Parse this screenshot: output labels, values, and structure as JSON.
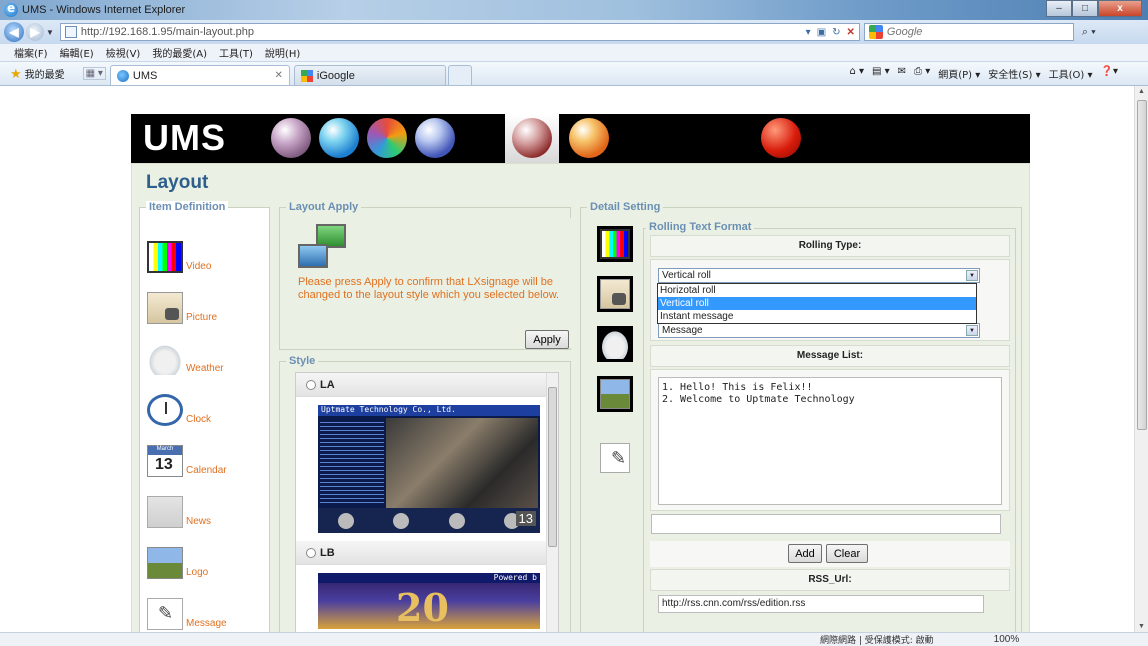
{
  "window": {
    "title": "UMS - Windows Internet Explorer",
    "min": "–",
    "max": "□",
    "close": "x"
  },
  "address": {
    "url": "http://192.168.1.95/main-layout.php",
    "search_placeholder": "Google"
  },
  "menu": [
    "檔案(F)",
    "編輯(E)",
    "檢視(V)",
    "我的最愛(A)",
    "工具(T)",
    "說明(H)"
  ],
  "favorites": {
    "label": "我的最愛"
  },
  "tabs": [
    {
      "label": "UMS",
      "active": true
    },
    {
      "label": "iGoogle",
      "active": false
    }
  ],
  "command_bar": [
    "網頁(P) ▾",
    "安全性(S) ▾",
    "工具(O) ▾"
  ],
  "status": {
    "zone": "網際網路 | 受保護模式: 啟動",
    "zoom": "100%"
  },
  "app": {
    "logo": "UMS",
    "page_title": "Layout"
  },
  "item_definition": {
    "legend": "Item Definition",
    "items": [
      {
        "label": "Video",
        "icon": "video-icon"
      },
      {
        "label": "Picture",
        "icon": "picture-icon"
      },
      {
        "label": "Weather",
        "icon": "weather-icon"
      },
      {
        "label": "Clock",
        "icon": "clock-icon"
      },
      {
        "label": "Calendar",
        "icon": "calendar-icon"
      },
      {
        "label": "News",
        "icon": "news-icon"
      },
      {
        "label": "Logo",
        "icon": "logo-icon"
      },
      {
        "label": "Message",
        "icon": "message-icon"
      }
    ]
  },
  "layout_apply": {
    "legend": "Layout Apply",
    "message": "Please press Apply to confirm that LXsignage will be changed to the layout style which you selected below.",
    "apply_label": "Apply"
  },
  "style": {
    "legend": "Style",
    "options": [
      {
        "label": "LA",
        "banner": "Uptmate Technology Co., Ltd.",
        "number": "13"
      },
      {
        "label": "LB",
        "banner": "Powered b",
        "big": "20"
      }
    ]
  },
  "detail": {
    "legend": "Detail Setting",
    "rolling_legend": "Rolling Text Format",
    "rolling_type_title": "Rolling Type:",
    "rolling_type_value": "Vertical roll",
    "rolling_type_options": [
      "Horizotal roll",
      "Vertical roll",
      "Instant message"
    ],
    "rolling_type_selected": 1,
    "second_select_value": "Message",
    "message_list_title": "Message List:",
    "message_list": "1. Hello! This is Felix!!\n2. Welcome to Uptmate Technology",
    "message_input": "",
    "add_label": "Add",
    "clear_label": "Clear",
    "rss_title": "RSS_Url:",
    "rss_value": "http://rss.cnn.com/rss/edition.rss"
  }
}
